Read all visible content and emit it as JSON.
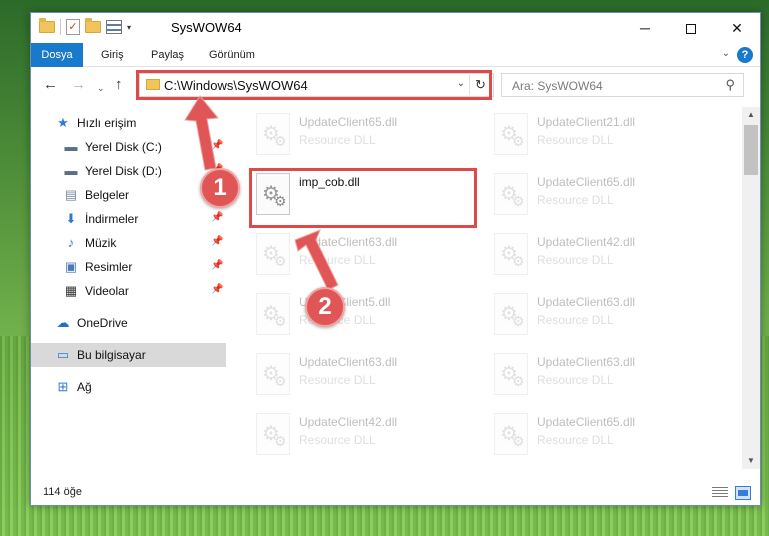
{
  "window": {
    "title": "SysWOW64",
    "controls": {
      "minimize": "─",
      "maximize": "",
      "close": "✕"
    }
  },
  "quick_access_toolbar": {
    "dropdown": "▾"
  },
  "ribbon": {
    "tabs": [
      "Dosya",
      "Giriş",
      "Paylaş",
      "Görünüm"
    ],
    "collapse_chevron": "⌄",
    "help": "?"
  },
  "nav": {
    "back": "←",
    "forward": "→",
    "recent": "⌄",
    "up": "↑",
    "address": "C:\\Windows\\SysWOW64",
    "address_dropdown": "⌄",
    "refresh": "↻",
    "search_placeholder": "Ara: SysWOW64",
    "search_icon": "⚲"
  },
  "sidebar": {
    "items": [
      {
        "label": "Hızlı erişim",
        "icon": "star-icon",
        "glyph": "★",
        "color": "#2e7bd6",
        "pinned": false
      },
      {
        "label": "Yerel Disk (C:)",
        "icon": "drive-icon",
        "glyph": "▬",
        "color": "#5b6e86",
        "pinned": true
      },
      {
        "label": "Yerel Disk (D:)",
        "icon": "drive-icon",
        "glyph": "▬",
        "color": "#5b6e86",
        "pinned": true
      },
      {
        "label": "Belgeler",
        "icon": "documents-icon",
        "glyph": "▤",
        "color": "#7a8aa0",
        "pinned": true
      },
      {
        "label": "İndirmeler",
        "icon": "download-icon",
        "glyph": "⬇",
        "color": "#2e7bd6",
        "pinned": true
      },
      {
        "label": "Müzik",
        "icon": "music-icon",
        "glyph": "♪",
        "color": "#2e7bd6",
        "pinned": true
      },
      {
        "label": "Resimler",
        "icon": "pictures-icon",
        "glyph": "▣",
        "color": "#4a7ab8",
        "pinned": true
      },
      {
        "label": "Videolar",
        "icon": "video-icon",
        "glyph": "▦",
        "color": "#333333",
        "pinned": true
      },
      {
        "label": "OneDrive",
        "icon": "cloud-icon",
        "glyph": "☁",
        "color": "#1f6fc5",
        "pinned": false
      },
      {
        "label": "Bu bilgisayar",
        "icon": "computer-icon",
        "glyph": "▭",
        "color": "#2e7bd6",
        "pinned": false
      },
      {
        "label": "Ağ",
        "icon": "network-icon",
        "glyph": "⊞",
        "color": "#2e7bd6",
        "pinned": false
      }
    ],
    "pin_glyph": "📌"
  },
  "files": {
    "col1": [
      {
        "name": "UpdateClient65.dll",
        "type": "Resource DLL"
      },
      {
        "name": "imp_cob.dll",
        "type": ""
      },
      {
        "name": "UpdateClient63.dll",
        "type": "Resource DLL"
      },
      {
        "name": "UpdateClient5.dll",
        "type": "Resource DLL"
      },
      {
        "name": "UpdateClient63.dll",
        "type": "Resource DLL"
      },
      {
        "name": "UpdateClient42.dll",
        "type": "Resource DLL"
      }
    ],
    "col2": [
      {
        "name": "UpdateClient21.dll",
        "type": "Resource DLL"
      },
      {
        "name": "UpdateClient65.dll",
        "type": "Resource DLL"
      },
      {
        "name": "UpdateClient42.dll",
        "type": "Resource DLL"
      },
      {
        "name": "UpdateClient63.dll",
        "type": "Resource DLL"
      },
      {
        "name": "UpdateClient63.dll",
        "type": "Resource DLL"
      },
      {
        "name": "UpdateClient65.dll",
        "type": "Resource DLL"
      }
    ]
  },
  "scrollbar": {
    "up": "▲",
    "down": "▼"
  },
  "status": {
    "item_count": "114 öğe"
  },
  "annotations": {
    "callout_1": "1",
    "callout_2": "2",
    "color": "#dc4a4a"
  }
}
